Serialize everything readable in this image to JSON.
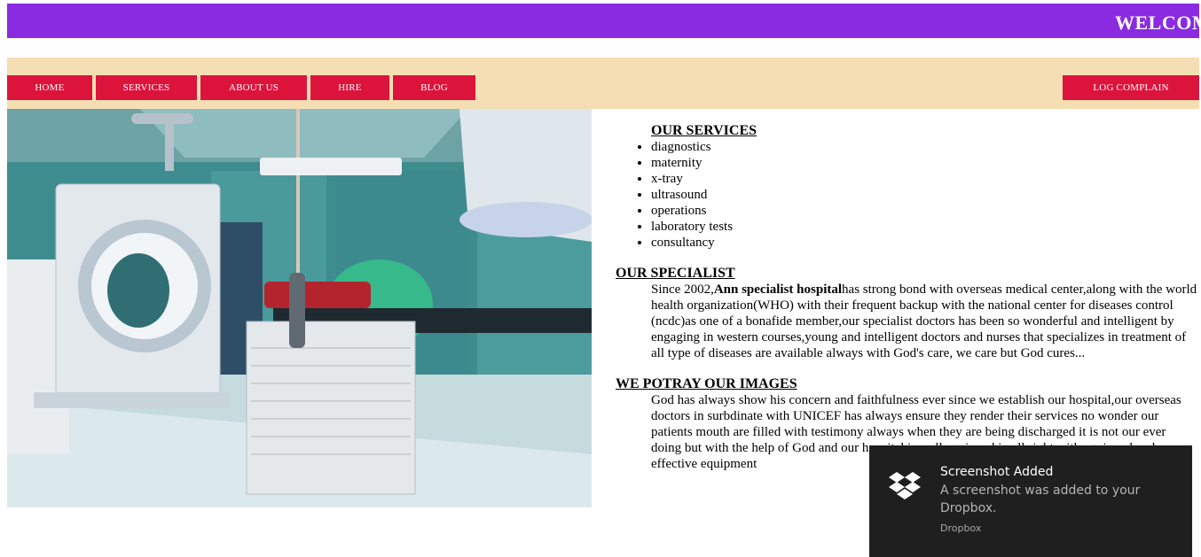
{
  "banner": {
    "text": "WELCOME"
  },
  "nav": {
    "items": [
      {
        "label": "HOME"
      },
      {
        "label": "SERVICES"
      },
      {
        "label": "ABOUT US"
      },
      {
        "label": "HIRE"
      },
      {
        "label": "BLOG"
      }
    ],
    "log_complain": "LOG COMPLAIN"
  },
  "colors": {
    "banner": "#8a2be2",
    "nav_bg": "#f5deb3",
    "nav_button": "#dc143c"
  },
  "hero": {
    "image": "hospital-scanner-room-photo"
  },
  "services": {
    "heading": "OUR SERVICES",
    "items": [
      "diagnostics",
      "maternity",
      "x-tray",
      "ultrasound",
      "operations",
      "laboratory tests",
      "consultancy"
    ]
  },
  "specialist": {
    "heading": "OUR SPECIALIST",
    "text_before": "Since 2002,",
    "bold": "Ann specialist hospital",
    "text_after": "has strong bond with overseas medical center,along with the world health organization(WHO) with their frequent backup with the national center for diseases control (ncdc)as one of a bonafide member,our specialist doctors has been so wonderful and intelligent by engaging in western courses,young and intelligent doctors and nurses that specializes in treatment of all type of diseases are available always with God's care, we care but God cures..."
  },
  "images": {
    "heading": "WE POTRAY OUR IMAGES",
    "text": "God has always show his concern and faithfulness ever since we establish our hospital,our overseas doctors in surbdinate with UNICEF has always ensure they render their services no wonder our patients mouth are filled with testimony always when they are being discharged it is not our ever doing but with the help of God and our hospital is well equipped in all right with equipped and effective equipment"
  },
  "toast": {
    "title": "Screenshot Added",
    "body": "A screenshot was added to your Dropbox.",
    "app": "Dropbox",
    "icon": "dropbox-icon"
  }
}
